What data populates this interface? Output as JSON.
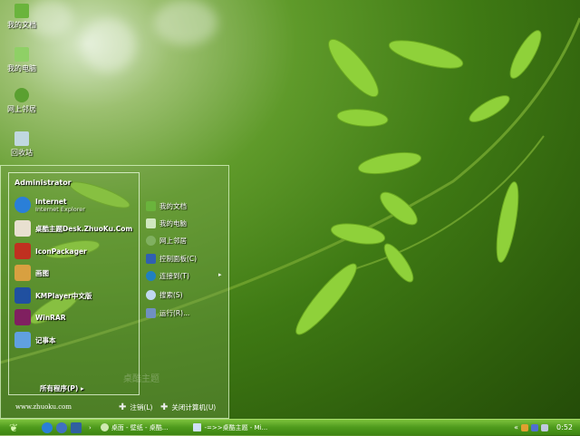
{
  "desktop_icons": [
    {
      "label": "我的文档",
      "icon": "folder-icon",
      "color": "#6ab43c"
    },
    {
      "label": "我的电脑",
      "icon": "home-icon",
      "color": "#8fd066"
    },
    {
      "label": "网上邻居",
      "icon": "globe-icon",
      "color": "#5aa030"
    },
    {
      "label": "回收站",
      "icon": "recycle-bin-icon",
      "color": "#c0d8e0"
    }
  ],
  "start_menu": {
    "user": "Administrator",
    "programs": [
      {
        "label": "Internet",
        "sub": "Internet Explorer",
        "icon": "ie-icon",
        "color": "#2a7fd8"
      },
      {
        "label": "桌酷主题Desk.ZhuoKu.Com",
        "icon": "theme-icon",
        "color": "#e8e0d0"
      },
      {
        "label": "IconPackager",
        "icon": "iconpackager-icon",
        "color": "#c03020"
      },
      {
        "label": "画图",
        "icon": "paint-icon",
        "color": "#d8a040"
      },
      {
        "label": "KMPlayer中文版",
        "icon": "kmplayer-icon",
        "color": "#2050a0"
      },
      {
        "label": "WinRAR",
        "icon": "winrar-icon",
        "color": "#802060"
      },
      {
        "label": "记事本",
        "icon": "notepad-icon",
        "color": "#60a0e0"
      }
    ],
    "all_programs": "所有程序(P)",
    "right_items": [
      {
        "label": "我的文档",
        "icon": "folder-icon",
        "color": "#6ab43c"
      },
      {
        "label": "我的电脑",
        "icon": "home-icon",
        "color": "#d0e8c0"
      },
      {
        "label": "网上邻居",
        "icon": "globe-icon",
        "color": "#80b060"
      },
      {
        "label": "控制面板(C)",
        "icon": "control-panel-icon",
        "color": "#3060b0"
      },
      {
        "label": "连接到(T)",
        "icon": "connect-icon",
        "color": "#2080c0"
      },
      {
        "label": "搜索(S)",
        "icon": "search-icon",
        "color": "#c0d8f0"
      },
      {
        "label": "运行(R)...",
        "icon": "run-icon",
        "color": "#7090c0"
      }
    ],
    "website": "www.zhuoku.com",
    "logoff": "注销(L)",
    "shutdown": "关闭计算机(U)",
    "watermark": "桌酷主题"
  },
  "taskbar": {
    "tasks": [
      "桌面 - 壁纸 - 桌酷...",
      "-=>>桌酷主题 - Mi..."
    ],
    "time": "0:52"
  }
}
